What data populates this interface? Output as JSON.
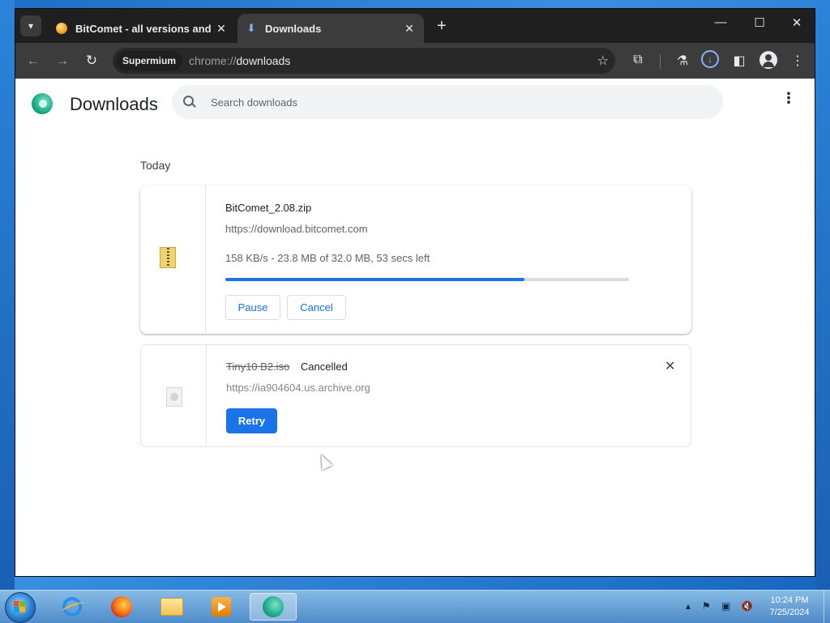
{
  "browser": {
    "tabs": [
      {
        "title": "BitComet - all versions and zip",
        "active": false
      },
      {
        "title": "Downloads",
        "active": true
      }
    ],
    "new_tab": "+",
    "window_controls": {
      "minimize": "—",
      "maximize": "☐",
      "close": "✕"
    },
    "toolbar": {
      "profile_chip": "Supermium",
      "url_scheme": "chrome://",
      "url_path": "downloads"
    }
  },
  "page": {
    "title": "Downloads",
    "search_placeholder": "Search downloads",
    "date_heading": "Today",
    "downloads": [
      {
        "filename": "BitComet_2.08.zip",
        "url": "https://download.bitcomet.com",
        "status": "158 KB/s - 23.8 MB of 32.0 MB, 53 secs left",
        "progress": 0.74,
        "buttons": {
          "pause": "Pause",
          "cancel": "Cancel"
        }
      },
      {
        "filename": "Tiny10 B2.iso",
        "state": "Cancelled",
        "url": "https://ia904604.us.archive.org",
        "buttons": {
          "retry": "Retry"
        }
      }
    ]
  },
  "taskbar": {
    "clock_time": "10:24 PM",
    "clock_date": "7/25/2024"
  },
  "colors": {
    "accent": "#1a73e8",
    "progress_track": "#dadce0",
    "tabbar": "#1f1f1f",
    "toolbar": "#3c3c3c"
  }
}
